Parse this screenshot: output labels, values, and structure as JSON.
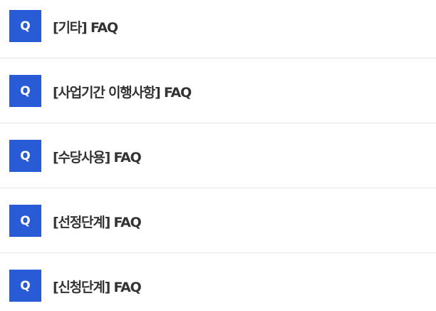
{
  "faq": {
    "badge_label": "Q",
    "items": [
      {
        "title": "[기타] FAQ"
      },
      {
        "title": "[사업기간 이행사항] FAQ"
      },
      {
        "title": "[수당사용] FAQ"
      },
      {
        "title": "[선정단계] FAQ"
      },
      {
        "title": "[신청단계] FAQ"
      }
    ]
  },
  "colors": {
    "badge_background": "#2a5bd7",
    "title_text": "#333333",
    "divider": "#e5e5e5"
  }
}
